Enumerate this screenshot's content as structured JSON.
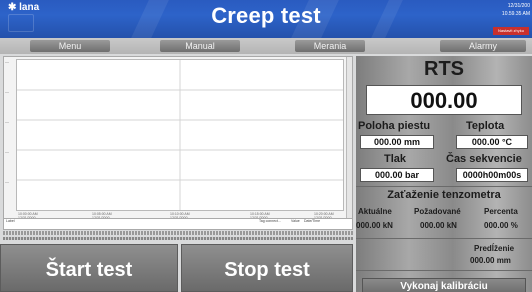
{
  "header": {
    "logo": "✱ lana",
    "title": "Creep test",
    "date": "12/31/200",
    "time": "10.59.35 AM",
    "status_button": "Nastavit zhyku"
  },
  "tabs": [
    "Menu",
    "Manual",
    "Merania",
    "Alarmy"
  ],
  "chart": {
    "x_ticks": [
      "10:00:00 AM",
      "10:05:00 AM",
      "10:10:00 AM",
      "10:15:00 AM",
      "10:20:00 AM"
    ],
    "x_dates": [
      "12/31/2000",
      "12/31/2000",
      "12/31/2000",
      "12/31/2000",
      "12/31/2000"
    ],
    "table_headers": [
      "Label",
      "Tag connect...",
      "Value",
      "Date/Time"
    ]
  },
  "buttons": {
    "start": "Štart test",
    "stop": "Stop test",
    "calibrate": "Vykonaj kalibráciu"
  },
  "panel": {
    "title": "RTS",
    "main_value": "000.00",
    "piston_label": "Poloha piestu",
    "piston_value": "000.00 mm",
    "temp_label": "Teplota",
    "temp_value": "000.00 °C",
    "pressure_label": "Tlak",
    "pressure_value": "000.00 bar",
    "seq_label": "Čas sekvencie",
    "seq_value": "0000h00m00s",
    "load_title": "Zaťaženie tenzometra",
    "col_actual": "Aktuálne",
    "col_required": "Požadované",
    "col_percent": "Percenta",
    "val_actual": "000.00 kN",
    "val_required": "000.00 kN",
    "val_percent": "000.00 %",
    "elong_label": "Predĺženie",
    "elong_value": "000.00 mm"
  },
  "colors": {
    "header_blue": "#2d63c9",
    "panel_grey": "#a8a8a8",
    "button_grey": "#7a7a7a"
  }
}
